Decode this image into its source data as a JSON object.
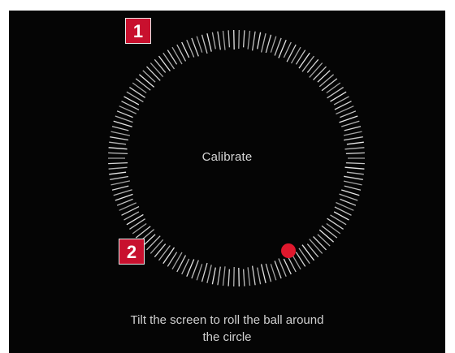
{
  "screen": {
    "center_text": "Calibrate",
    "instruction_lines": [
      "Tilt the screen to roll the ball around",
      "the circle"
    ]
  },
  "badges": [
    {
      "label": "1"
    },
    {
      "label": "2"
    }
  ],
  "colors": {
    "background": "#050505",
    "tick": "#e6e6e6",
    "ball": "#e0182d",
    "badge": "#c8102e"
  }
}
